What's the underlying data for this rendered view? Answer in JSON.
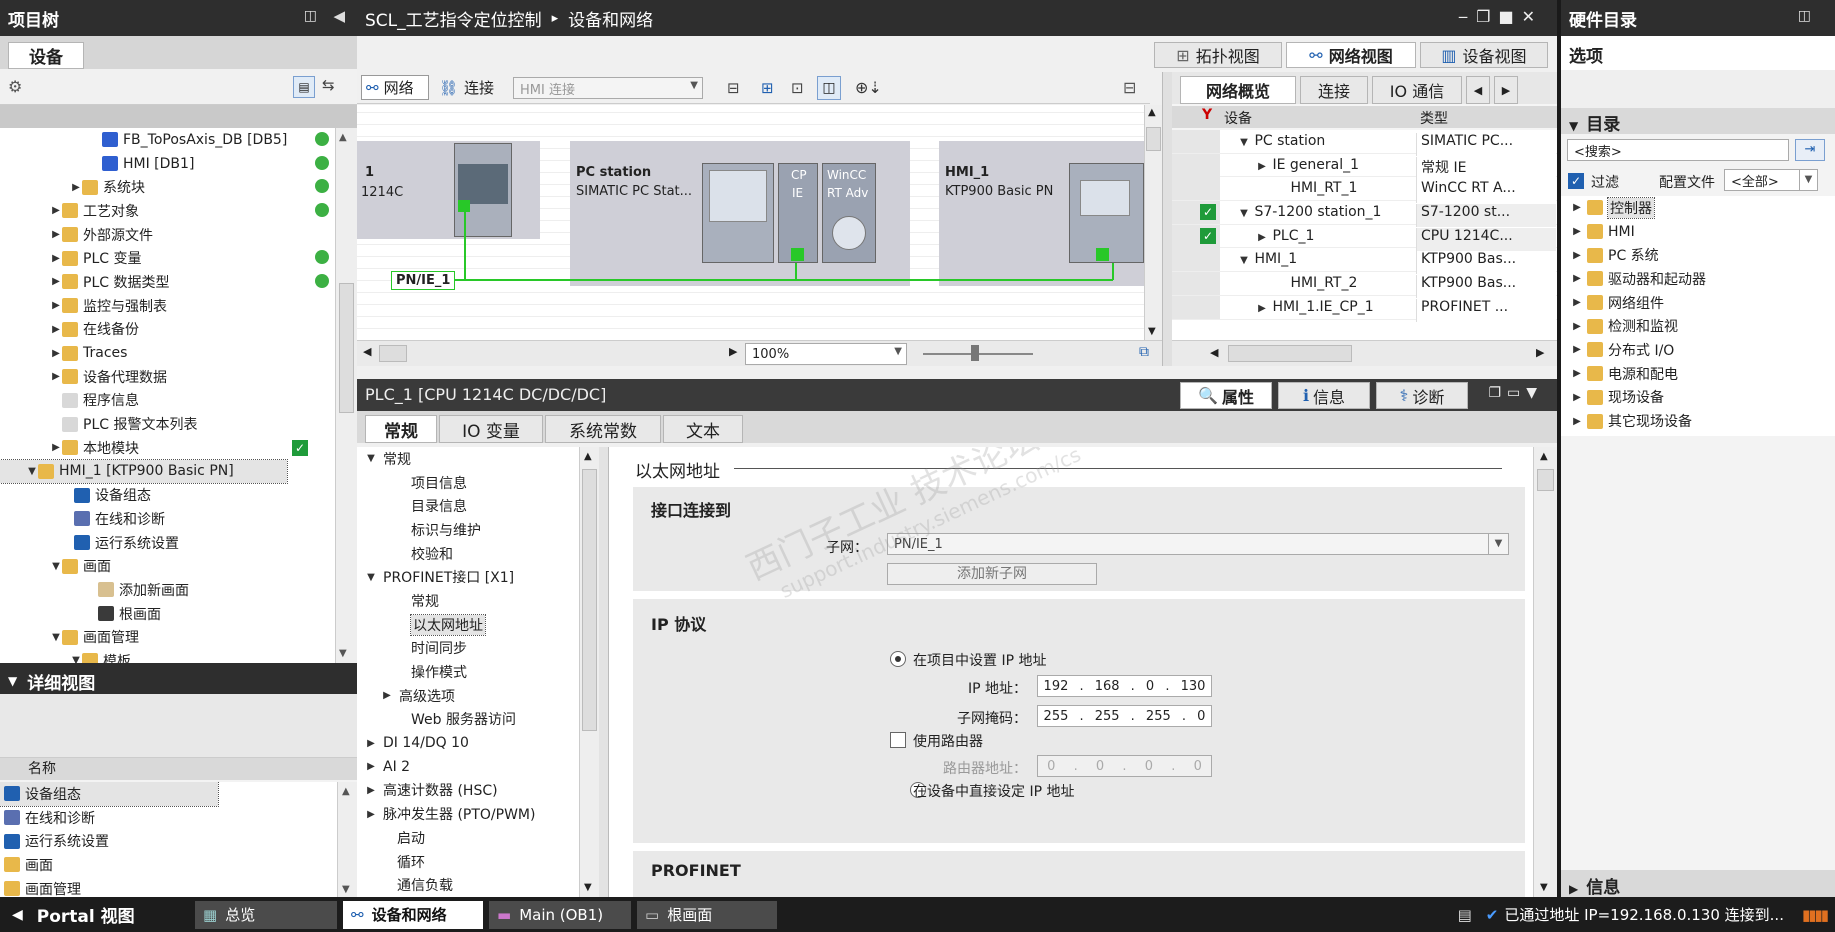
{
  "left": {
    "title": "项目树",
    "device_tab": "设备",
    "tree": [
      {
        "label": "FB_ToPosAxis_DB [DB5]",
        "indent": 90,
        "tri": "",
        "ico": "db",
        "status": "green"
      },
      {
        "label": "HMI [DB1]",
        "indent": 90,
        "tri": "",
        "ico": "db",
        "status": "green"
      },
      {
        "label": "系统块",
        "indent": 70,
        "tri": "▶",
        "ico": "folder",
        "status": "green"
      },
      {
        "label": "工艺对象",
        "indent": 50,
        "tri": "▶",
        "ico": "folder",
        "status": "green"
      },
      {
        "label": "外部源文件",
        "indent": 50,
        "tri": "▶",
        "ico": "folder",
        "status": ""
      },
      {
        "label": "PLC 变量",
        "indent": 50,
        "tri": "▶",
        "ico": "folder",
        "status": "green"
      },
      {
        "label": "PLC 数据类型",
        "indent": 50,
        "tri": "▶",
        "ico": "folder",
        "status": "green"
      },
      {
        "label": "监控与强制表",
        "indent": 50,
        "tri": "▶",
        "ico": "folder",
        "status": ""
      },
      {
        "label": "在线备份",
        "indent": 50,
        "tri": "▶",
        "ico": "folder",
        "status": ""
      },
      {
        "label": "Traces",
        "indent": 50,
        "tri": "▶",
        "ico": "folder",
        "status": ""
      },
      {
        "label": "设备代理数据",
        "indent": 50,
        "tri": "▶",
        "ico": "folder",
        "status": ""
      },
      {
        "label": "程序信息",
        "indent": 50,
        "tri": "",
        "ico": "doc",
        "status": ""
      },
      {
        "label": "PLC 报警文本列表",
        "indent": 50,
        "tri": "",
        "ico": "doc",
        "status": ""
      },
      {
        "label": "本地模块",
        "indent": 50,
        "tri": "▶",
        "ico": "folder",
        "status": "check"
      },
      {
        "label": "HMI_1 [KTP900 Basic PN]",
        "indent": 26,
        "tri": "▼",
        "ico": "folder",
        "status": "",
        "sel": true
      },
      {
        "label": "设备组态",
        "indent": 62,
        "tri": "",
        "ico": "cfg",
        "status": ""
      },
      {
        "label": "在线和诊断",
        "indent": 62,
        "tri": "",
        "ico": "diag",
        "status": ""
      },
      {
        "label": "运行系统设置",
        "indent": 62,
        "tri": "",
        "ico": "run",
        "status": ""
      },
      {
        "label": "画面",
        "indent": 50,
        "tri": "▼",
        "ico": "folder",
        "status": ""
      },
      {
        "label": "添加新画面",
        "indent": 86,
        "tri": "",
        "ico": "add",
        "status": ""
      },
      {
        "label": "根画面",
        "indent": 86,
        "tri": "",
        "ico": "scr",
        "status": ""
      },
      {
        "label": "画面管理",
        "indent": 50,
        "tri": "▼",
        "ico": "folder",
        "status": ""
      },
      {
        "label": "模板",
        "indent": 70,
        "tri": "▼",
        "ico": "folder",
        "status": ""
      }
    ],
    "detail_title": "详细视图",
    "detail_col": "名称",
    "detail_items": [
      "设备组态",
      "在线和诊断",
      "运行系统设置",
      "画面",
      "画面管理"
    ]
  },
  "center": {
    "breadcrumb_project": "SCL_工艺指令定位控制",
    "breadcrumb_sep": "▸",
    "breadcrumb_page": "设备和网络",
    "view_tabs": [
      "拓扑视图",
      "网络视图",
      "设备视图"
    ],
    "toolbar": {
      "network": "网络",
      "connect": "连接",
      "hmi_conn": "HMI 连接"
    },
    "canvas": {
      "plc_name": "1",
      "plc_type": "1214C",
      "pc_name": "PC station",
      "pc_type": "SIMATIC PC Stat...",
      "cp_label1": "CP",
      "cp_label2": "IE",
      "wincc1": "WinCC",
      "wincc2": "RT Adv",
      "hmi_name": "HMI_1",
      "hmi_type": "KTP900 Basic PN",
      "subnet": "PN/IE_1"
    },
    "zoom": "100%",
    "overview": {
      "tabs": [
        "网络概览",
        "连接",
        "IO 通信"
      ],
      "col_device": "设备",
      "col_type": "类型",
      "rows": [
        {
          "name": "PC station",
          "type": "SIMATIC PC...",
          "indent": 18,
          "tri": "▼",
          "chk": false
        },
        {
          "name": "IE general_1",
          "type": "常规 IE",
          "indent": 36,
          "tri": "▶",
          "chk": false
        },
        {
          "name": "HMI_RT_1",
          "type": "WinCC RT A...",
          "indent": 54,
          "tri": "",
          "chk": false
        },
        {
          "name": "S7-1200 station_1",
          "type": "S7-1200 st...",
          "indent": 18,
          "tri": "▼",
          "chk": true
        },
        {
          "name": "PLC_1",
          "type": "CPU 1214C...",
          "indent": 36,
          "tri": "▶",
          "chk": true
        },
        {
          "name": "HMI_1",
          "type": "KTP900 Bas...",
          "indent": 18,
          "tri": "▼",
          "chk": false
        },
        {
          "name": "HMI_RT_2",
          "type": "KTP900 Bas...",
          "indent": 54,
          "tri": "",
          "chk": false
        },
        {
          "name": "HMI_1.IE_CP_1",
          "type": "PROFINET ...",
          "indent": 36,
          "tri": "▶",
          "chk": false
        }
      ]
    }
  },
  "props": {
    "title": "PLC_1 [CPU 1214C DC/DC/DC]",
    "right_tabs": [
      "属性",
      "信息",
      "诊断"
    ],
    "tabs": [
      "常规",
      "IO 变量",
      "系统常数",
      "文本"
    ],
    "nav": [
      {
        "label": "常规",
        "indent": 8,
        "tri": "▼"
      },
      {
        "label": "项目信息",
        "indent": 36,
        "tri": ""
      },
      {
        "label": "目录信息",
        "indent": 36,
        "tri": ""
      },
      {
        "label": "标识与维护",
        "indent": 36,
        "tri": ""
      },
      {
        "label": "校验和",
        "indent": 36,
        "tri": ""
      },
      {
        "label": "PROFINET接口 [X1]",
        "indent": 8,
        "tri": "▼"
      },
      {
        "label": "常规",
        "indent": 36,
        "tri": ""
      },
      {
        "label": "以太网地址",
        "indent": 36,
        "tri": "",
        "sel": true
      },
      {
        "label": "时间同步",
        "indent": 36,
        "tri": ""
      },
      {
        "label": "操作模式",
        "indent": 36,
        "tri": ""
      },
      {
        "label": "高级选项",
        "indent": 24,
        "tri": "▶"
      },
      {
        "label": "Web 服务器访问",
        "indent": 36,
        "tri": ""
      },
      {
        "label": "DI 14/DQ 10",
        "indent": 8,
        "tri": "▶"
      },
      {
        "label": "AI 2",
        "indent": 8,
        "tri": "▶"
      },
      {
        "label": "高速计数器 (HSC)",
        "indent": 8,
        "tri": "▶"
      },
      {
        "label": "脉冲发生器 (PTO/PWM)",
        "indent": 8,
        "tri": "▶"
      },
      {
        "label": "启动",
        "indent": 22,
        "tri": ""
      },
      {
        "label": "循环",
        "indent": 22,
        "tri": ""
      },
      {
        "label": "通信负载",
        "indent": 22,
        "tri": ""
      }
    ],
    "section_title": "以太网地址",
    "iface_title": "接口连接到",
    "subnet_label": "子网：",
    "subnet_value": "PN/IE_1",
    "add_subnet": "添加新子网",
    "ip_title": "IP 协议",
    "set_ip_in_project": "在项目中设置 IP 地址",
    "ip_label": "IP 地址：",
    "ip": [
      "192",
      "168",
      "0",
      "130"
    ],
    "mask_label": "子网掩码：",
    "mask": [
      "255",
      "255",
      "255",
      "0"
    ],
    "use_router": "使用路由器",
    "router_label": "路由器地址：",
    "router": [
      "0",
      "0",
      "0",
      "0"
    ],
    "set_ip_on_device": "在设备中直接设定 IP 地址",
    "profinet_title": "PROFINET"
  },
  "right": {
    "title": "硬件目录",
    "options": "选项",
    "catalog": "目录",
    "search_placeholder": "<搜索>",
    "filter": "过滤",
    "profile_label": "配置文件",
    "profile_value": "<全部>",
    "items": [
      "控制器",
      "HMI",
      "PC 系统",
      "驱动器和起动器",
      "网络组件",
      "检测和监视",
      "分布式 I/O",
      "电源和配电",
      "现场设备",
      "其它现场设备"
    ],
    "info": "信息"
  },
  "taskbar": {
    "portal": "Portal 视图",
    "items": [
      "总览",
      "设备和网络",
      "Main (OB1)",
      "根画面"
    ],
    "status": "已通过地址 IP=192.168.0.130 连接到..."
  },
  "watermark": {
    "line1": "西门子工业 技术论坛",
    "line2": "support.industry.siemens.com/cs"
  },
  "colors": {
    "green": "#3cb043",
    "link": "#28c828",
    "header": "#2e2e2e",
    "selected": "#cfe0f5"
  }
}
